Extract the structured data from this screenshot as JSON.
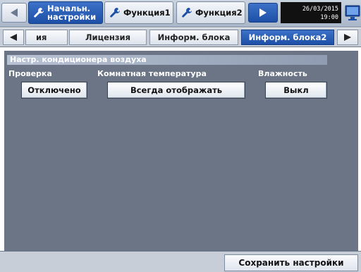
{
  "top_tabs": {
    "tab_initial_line1": "Начальн.",
    "tab_initial_line2": "настройки",
    "tab_function1": "Функция1",
    "tab_function2": "Функция2"
  },
  "clock": {
    "date": "26/03/2015",
    "time": "19:00"
  },
  "sub_tabs": {
    "partial": "ия",
    "license": "Лицензия",
    "unit_info": "Информ. блока",
    "unit_info2": "Информ. блока2"
  },
  "section": {
    "title": "Настр. кондиционера воздуха",
    "check_label": "Проверка",
    "check_value": "Отключено",
    "room_temp_label": "Комнатная температура",
    "room_temp_value": "Всегда отображать",
    "humidity_label": "Влажность",
    "humidity_value": "Выкл"
  },
  "footer": {
    "save_label": "Сохранить настройки"
  },
  "colors": {
    "accent": "#1d4fa6",
    "panel": "#6b7585",
    "bar": "#c7ced8"
  },
  "icons": [
    "wrench-icon",
    "arrow-left-icon",
    "arrow-right-icon",
    "monitor-icon"
  ]
}
